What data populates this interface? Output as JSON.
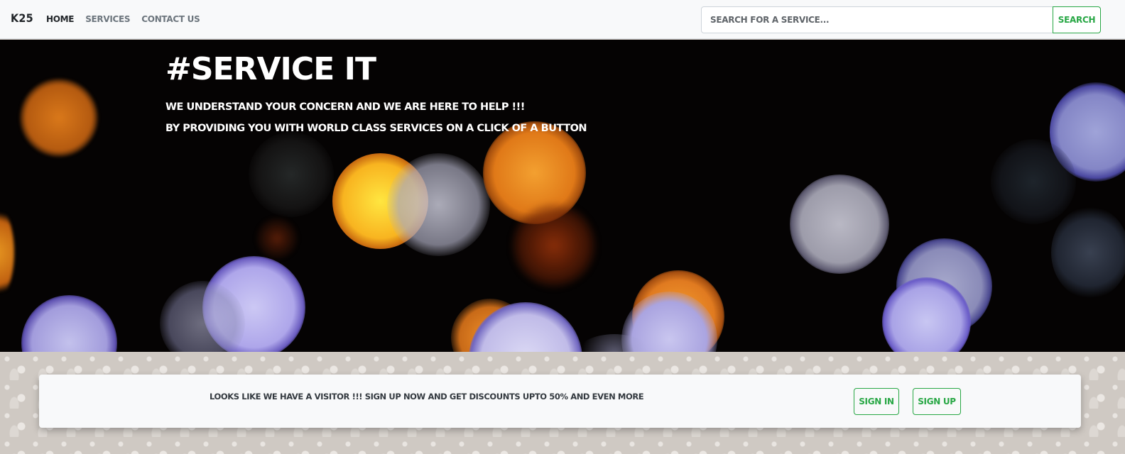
{
  "navbar": {
    "brand": "K25",
    "links": [
      {
        "label": "Home",
        "active": true
      },
      {
        "label": "Services",
        "active": false
      },
      {
        "label": "Contact Us",
        "active": false
      }
    ],
    "search": {
      "placeholder": "Search for a service...",
      "value": "",
      "button_label": "Search"
    }
  },
  "hero": {
    "title": "#Service It",
    "line1": "We understand your concern and we are here to help !!!",
    "line2": "By providing you with world class services on a click of a button"
  },
  "visitor_card": {
    "message": "Looks like we have a visitor !!! Sign up now and get discounts upto 50% and even more",
    "signin_label": "Sign In",
    "signup_label": "Sign Up"
  },
  "colors": {
    "accent": "#28a745",
    "navbar_bg": "#f8f9fa",
    "hero_bg": "#050303"
  }
}
